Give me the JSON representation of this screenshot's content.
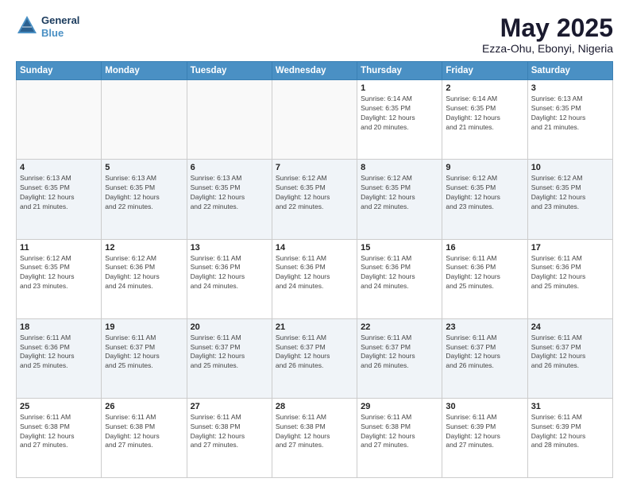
{
  "header": {
    "logo_line1": "General",
    "logo_line2": "Blue",
    "title": "May 2025",
    "subtitle": "Ezza-Ohu, Ebonyi, Nigeria"
  },
  "days_of_week": [
    "Sunday",
    "Monday",
    "Tuesday",
    "Wednesday",
    "Thursday",
    "Friday",
    "Saturday"
  ],
  "weeks": [
    [
      {
        "day": "",
        "info": ""
      },
      {
        "day": "",
        "info": ""
      },
      {
        "day": "",
        "info": ""
      },
      {
        "day": "",
        "info": ""
      },
      {
        "day": "1",
        "info": "Sunrise: 6:14 AM\nSunset: 6:35 PM\nDaylight: 12 hours\nand 20 minutes."
      },
      {
        "day": "2",
        "info": "Sunrise: 6:14 AM\nSunset: 6:35 PM\nDaylight: 12 hours\nand 21 minutes."
      },
      {
        "day": "3",
        "info": "Sunrise: 6:13 AM\nSunset: 6:35 PM\nDaylight: 12 hours\nand 21 minutes."
      }
    ],
    [
      {
        "day": "4",
        "info": "Sunrise: 6:13 AM\nSunset: 6:35 PM\nDaylight: 12 hours\nand 21 minutes."
      },
      {
        "day": "5",
        "info": "Sunrise: 6:13 AM\nSunset: 6:35 PM\nDaylight: 12 hours\nand 22 minutes."
      },
      {
        "day": "6",
        "info": "Sunrise: 6:13 AM\nSunset: 6:35 PM\nDaylight: 12 hours\nand 22 minutes."
      },
      {
        "day": "7",
        "info": "Sunrise: 6:12 AM\nSunset: 6:35 PM\nDaylight: 12 hours\nand 22 minutes."
      },
      {
        "day": "8",
        "info": "Sunrise: 6:12 AM\nSunset: 6:35 PM\nDaylight: 12 hours\nand 22 minutes."
      },
      {
        "day": "9",
        "info": "Sunrise: 6:12 AM\nSunset: 6:35 PM\nDaylight: 12 hours\nand 23 minutes."
      },
      {
        "day": "10",
        "info": "Sunrise: 6:12 AM\nSunset: 6:35 PM\nDaylight: 12 hours\nand 23 minutes."
      }
    ],
    [
      {
        "day": "11",
        "info": "Sunrise: 6:12 AM\nSunset: 6:35 PM\nDaylight: 12 hours\nand 23 minutes."
      },
      {
        "day": "12",
        "info": "Sunrise: 6:12 AM\nSunset: 6:36 PM\nDaylight: 12 hours\nand 24 minutes."
      },
      {
        "day": "13",
        "info": "Sunrise: 6:11 AM\nSunset: 6:36 PM\nDaylight: 12 hours\nand 24 minutes."
      },
      {
        "day": "14",
        "info": "Sunrise: 6:11 AM\nSunset: 6:36 PM\nDaylight: 12 hours\nand 24 minutes."
      },
      {
        "day": "15",
        "info": "Sunrise: 6:11 AM\nSunset: 6:36 PM\nDaylight: 12 hours\nand 24 minutes."
      },
      {
        "day": "16",
        "info": "Sunrise: 6:11 AM\nSunset: 6:36 PM\nDaylight: 12 hours\nand 25 minutes."
      },
      {
        "day": "17",
        "info": "Sunrise: 6:11 AM\nSunset: 6:36 PM\nDaylight: 12 hours\nand 25 minutes."
      }
    ],
    [
      {
        "day": "18",
        "info": "Sunrise: 6:11 AM\nSunset: 6:36 PM\nDaylight: 12 hours\nand 25 minutes."
      },
      {
        "day": "19",
        "info": "Sunrise: 6:11 AM\nSunset: 6:37 PM\nDaylight: 12 hours\nand 25 minutes."
      },
      {
        "day": "20",
        "info": "Sunrise: 6:11 AM\nSunset: 6:37 PM\nDaylight: 12 hours\nand 25 minutes."
      },
      {
        "day": "21",
        "info": "Sunrise: 6:11 AM\nSunset: 6:37 PM\nDaylight: 12 hours\nand 26 minutes."
      },
      {
        "day": "22",
        "info": "Sunrise: 6:11 AM\nSunset: 6:37 PM\nDaylight: 12 hours\nand 26 minutes."
      },
      {
        "day": "23",
        "info": "Sunrise: 6:11 AM\nSunset: 6:37 PM\nDaylight: 12 hours\nand 26 minutes."
      },
      {
        "day": "24",
        "info": "Sunrise: 6:11 AM\nSunset: 6:37 PM\nDaylight: 12 hours\nand 26 minutes."
      }
    ],
    [
      {
        "day": "25",
        "info": "Sunrise: 6:11 AM\nSunset: 6:38 PM\nDaylight: 12 hours\nand 27 minutes."
      },
      {
        "day": "26",
        "info": "Sunrise: 6:11 AM\nSunset: 6:38 PM\nDaylight: 12 hours\nand 27 minutes."
      },
      {
        "day": "27",
        "info": "Sunrise: 6:11 AM\nSunset: 6:38 PM\nDaylight: 12 hours\nand 27 minutes."
      },
      {
        "day": "28",
        "info": "Sunrise: 6:11 AM\nSunset: 6:38 PM\nDaylight: 12 hours\nand 27 minutes."
      },
      {
        "day": "29",
        "info": "Sunrise: 6:11 AM\nSunset: 6:38 PM\nDaylight: 12 hours\nand 27 minutes."
      },
      {
        "day": "30",
        "info": "Sunrise: 6:11 AM\nSunset: 6:39 PM\nDaylight: 12 hours\nand 27 minutes."
      },
      {
        "day": "31",
        "info": "Sunrise: 6:11 AM\nSunset: 6:39 PM\nDaylight: 12 hours\nand 28 minutes."
      }
    ]
  ]
}
